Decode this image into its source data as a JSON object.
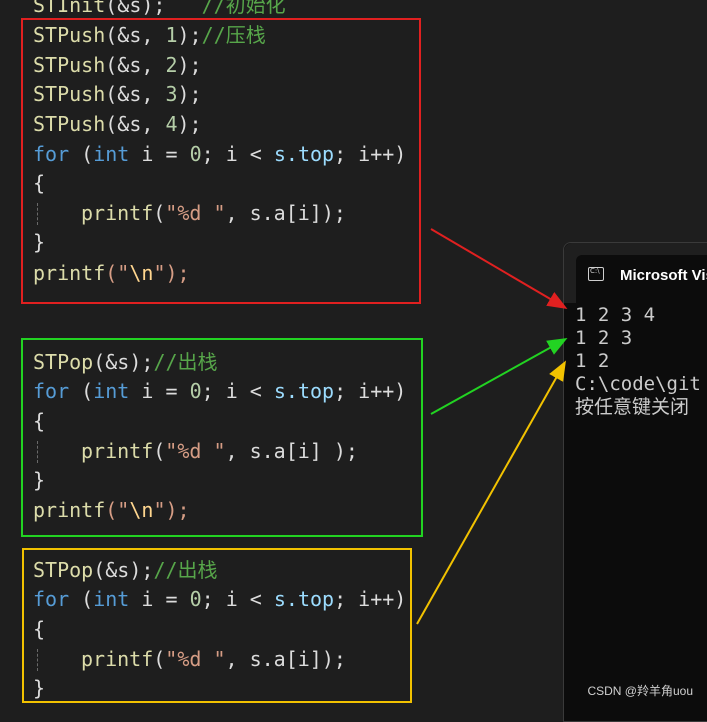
{
  "editor": {
    "lines": {
      "l0": {
        "a": "STInit",
        "b": "(&s);   ",
        "c": "//初始化"
      },
      "l1": {
        "a": "STPush",
        "b": "(&s, ",
        "c": "1",
        "d": ");",
        "e": "//压栈"
      },
      "l2": {
        "a": "STPush",
        "b": "(&s, ",
        "c": "2",
        "d": ");"
      },
      "l3": {
        "a": "STPush",
        "b": "(&s, ",
        "c": "3",
        "d": ");"
      },
      "l4": {
        "a": "STPush",
        "b": "(&s, ",
        "c": "4",
        "d": ");"
      },
      "l5": {
        "a": "for",
        "b": " (",
        "c": "int",
        "d": " i = ",
        "e": "0",
        "f": "; i < ",
        "g": "s.top",
        "h": "; i++)"
      },
      "l6": {
        "a": "{"
      },
      "l7": {
        "a": "printf",
        "b": "(",
        "c": "\"%d \"",
        "d": ", s.a[i]);"
      },
      "l8": {
        "a": "}"
      },
      "l9": {
        "a": "printf",
        "b": "(\"",
        "c": "\\n",
        "d": "\");"
      },
      "l10": {
        "a": "STPop",
        "b": "(&s);",
        "c": "//出栈"
      },
      "l11": {
        "a": "for",
        "b": " (",
        "c": "int",
        "d": " i = ",
        "e": "0",
        "f": "; i < ",
        "g": "s.top",
        "h": "; i++)"
      },
      "l12": {
        "a": "{"
      },
      "l13": {
        "a": "printf",
        "b": "(",
        "c": "\"%d \"",
        "d": ", s.a[i] );"
      },
      "l14": {
        "a": "}"
      },
      "l15": {
        "a": "printf",
        "b": "(\"",
        "c": "\\n",
        "d": "\");"
      },
      "l16": {
        "a": "STPop",
        "b": "(&s);",
        "c": "//出栈"
      },
      "l17": {
        "a": "for",
        "b": " (",
        "c": "int",
        "d": " i = ",
        "e": "0",
        "f": "; i < ",
        "g": "s.top",
        "h": "; i++)"
      },
      "l18": {
        "a": "{"
      },
      "l19": {
        "a": "printf",
        "b": "(",
        "c": "\"%d \"",
        "d": ", s.a[i]);"
      },
      "l20": {
        "a": "}"
      }
    }
  },
  "console": {
    "title": "Microsoft Vis",
    "output": [
      "1 2 3 4",
      "1 2 3",
      "1 2",
      "C:\\code\\git",
      "按任意键关闭"
    ]
  },
  "annotations": {
    "red": "#e02020",
    "green": "#22d322",
    "yellow": "#f2c200"
  },
  "watermark": "CSDN @羚羊角uou"
}
